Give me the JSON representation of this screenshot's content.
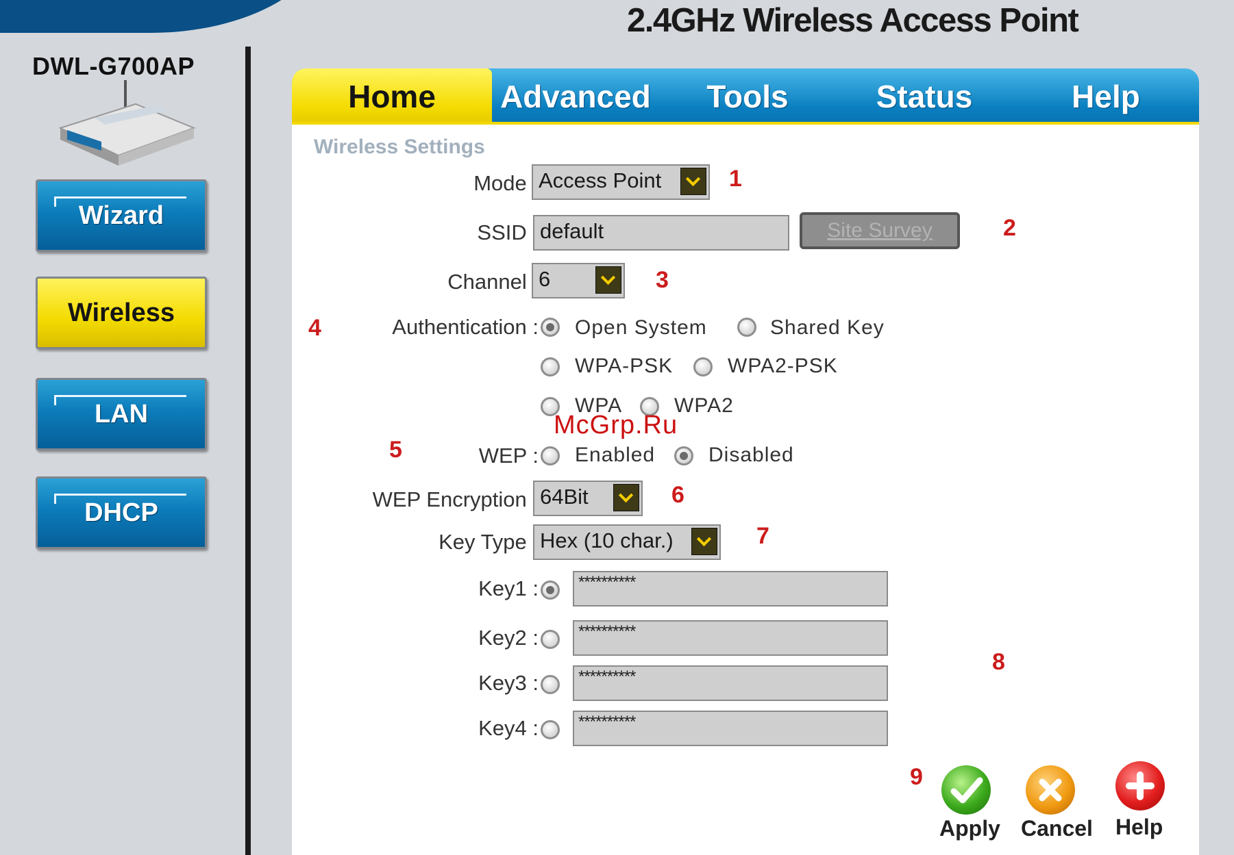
{
  "header": {
    "product_title": "2.4GHz Wireless Access Point"
  },
  "sidebar": {
    "model": "DWL-G700AP",
    "buttons": [
      {
        "label": "Wizard"
      },
      {
        "label": "Wireless"
      },
      {
        "label": "LAN"
      },
      {
        "label": "DHCP"
      }
    ]
  },
  "tabs": [
    {
      "label": "Home"
    },
    {
      "label": "Advanced"
    },
    {
      "label": "Tools"
    },
    {
      "label": "Status"
    },
    {
      "label": "Help"
    }
  ],
  "section_title": "Wireless Settings",
  "form": {
    "mode": {
      "label": "Mode :",
      "value": "Access Point"
    },
    "ssid": {
      "label": "SSID :",
      "value": "default",
      "survey_button": "Site Survey"
    },
    "channel": {
      "label": "Channel :",
      "value": "6"
    },
    "authentication": {
      "label": "Authentication :",
      "options": [
        "Open System",
        "Shared Key",
        "WPA-PSK",
        "WPA2-PSK",
        "WPA",
        "WPA2"
      ],
      "selected": "Open System"
    },
    "wep": {
      "label": "WEP :",
      "options": [
        "Enabled",
        "Disabled"
      ],
      "selected": "Disabled"
    },
    "wep_encryption": {
      "label": "WEP Encryption :",
      "value": "64Bit"
    },
    "key_type": {
      "label": "Key Type :",
      "value": "Hex (10 char.)"
    },
    "keys": [
      {
        "label": "Key1 :",
        "value": "**********",
        "selected": true
      },
      {
        "label": "Key2 :",
        "value": "**********",
        "selected": false
      },
      {
        "label": "Key3 :",
        "value": "**********",
        "selected": false
      },
      {
        "label": "Key4 :",
        "value": "**********",
        "selected": false
      }
    ]
  },
  "annotations": [
    "1",
    "2",
    "3",
    "4",
    "5",
    "6",
    "7",
    "8",
    "9"
  ],
  "actions": {
    "apply": "Apply",
    "cancel": "Cancel",
    "help": "Help"
  },
  "watermark": "McGrp.Ru"
}
